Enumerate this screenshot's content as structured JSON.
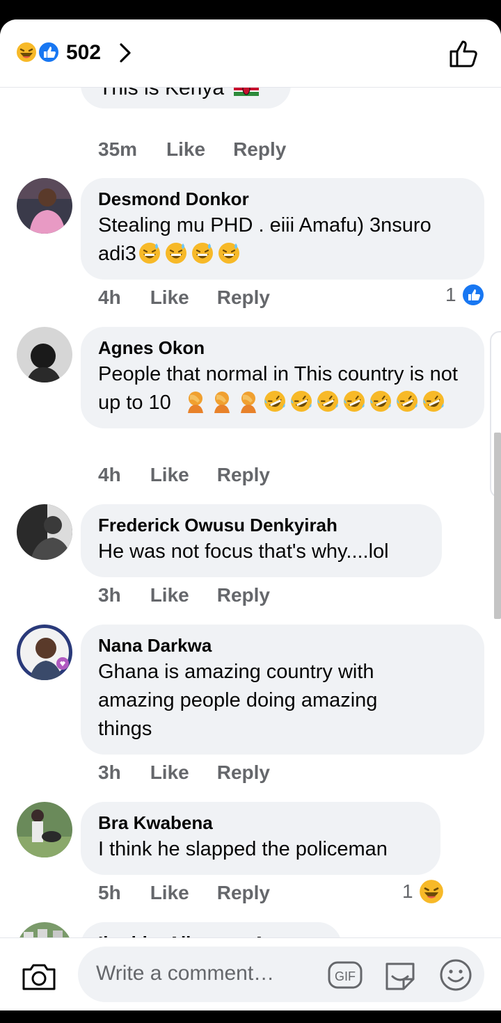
{
  "header": {
    "reaction_count": "502",
    "reaction_icons": [
      "laugh-icon",
      "like-icon"
    ]
  },
  "partial_comment": {
    "text": "This is Kenya",
    "time": "35m",
    "like": "Like",
    "reply": "Reply"
  },
  "comments": [
    {
      "author": "Desmond Donkor",
      "text": "Stealing mu PHD . eiii Amafu) 3nsuro adi3",
      "emoji_count": 4,
      "time": "4h",
      "like": "Like",
      "reply": "Reply",
      "reaction_count": "1",
      "reaction_icon": "like-icon"
    },
    {
      "author": "Agnes Okon",
      "text": "People that normal in This country is not up to 10",
      "time": "4h",
      "like": "Like",
      "reply": "Reply"
    },
    {
      "author": "Frederick Owusu Denkyirah",
      "text": "He was not focus that's why....lol",
      "time": "3h",
      "like": "Like",
      "reply": "Reply"
    },
    {
      "author": "Nana Darkwa",
      "text": "Ghana is amazing country with amazing people doing amazing things",
      "time": "3h",
      "like": "Like",
      "reply": "Reply"
    },
    {
      "author": "Bra Kwabena",
      "text": "I think he slapped the policeman",
      "time": "5h",
      "like": "Like",
      "reply": "Reply",
      "reaction_count": "1",
      "reaction_icon": "laugh-icon"
    },
    {
      "author": "Ibrahim Alhassan Anas"
    }
  ],
  "composer": {
    "placeholder": "Write a comment…",
    "gif_label": "GIF"
  },
  "colors": {
    "like_blue": "#1877f2",
    "bubble_bg": "#f0f2f5",
    "muted_text": "#65676b",
    "emoji_yellow": "#f7b928"
  }
}
